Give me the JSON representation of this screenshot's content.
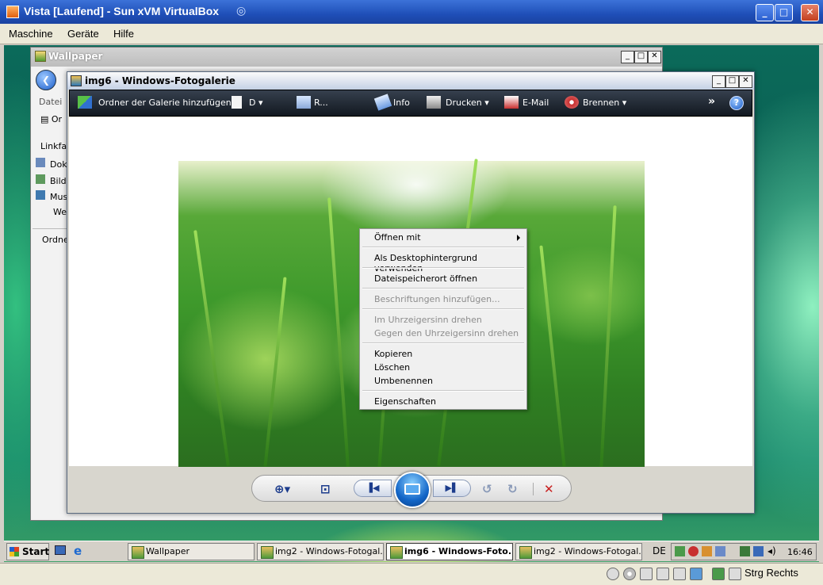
{
  "host": {
    "title": "Vista [Laufend] - Sun xVM VirtualBox",
    "menu": [
      "Maschine",
      "Geräte",
      "Hilfe"
    ],
    "host_key_label": "Strg Rechts"
  },
  "wallpaper_window": {
    "title": "Wallpaper",
    "menu_datei": "Datei",
    "toolbar_fragment": "Or",
    "nav_header": "Linkfav",
    "links": [
      "Dok",
      "Bild",
      "Mus",
      "We"
    ],
    "folders_label": "Ordne"
  },
  "gallery": {
    "title": "img6 - Windows-Fotogalerie",
    "toolbar": {
      "add_folder": "Ordner der Galerie hinzufügen",
      "file": "D",
      "fix": "R...",
      "info": "Info",
      "print": "Drucken",
      "email": "E-Mail",
      "burn": "Brennen",
      "more": "»",
      "help": "?"
    }
  },
  "context_menu": {
    "open_with": "Öffnen mit",
    "set_desktop": "Als Desktophintergrund verwenden",
    "open_location": "Dateispeicherort öffnen",
    "add_caption": "Beschriftungen hinzufügen...",
    "rotate_cw": "Im Uhrzeigersinn drehen",
    "rotate_ccw": "Gegen den Uhrzeigersinn drehen",
    "copy": "Kopieren",
    "delete": "Löschen",
    "rename": "Umbenennen",
    "properties": "Eigenschaften"
  },
  "taskbar": {
    "start": "Start",
    "tasks": [
      {
        "label": "Wallpaper",
        "active": false
      },
      {
        "label": "img2 - Windows-Fotogal...",
        "active": false
      },
      {
        "label": "img6 - Windows-Foto...",
        "active": true
      },
      {
        "label": "img2 - Windows-Fotogal...",
        "active": false
      }
    ],
    "language": "DE",
    "clock": "16:46"
  }
}
